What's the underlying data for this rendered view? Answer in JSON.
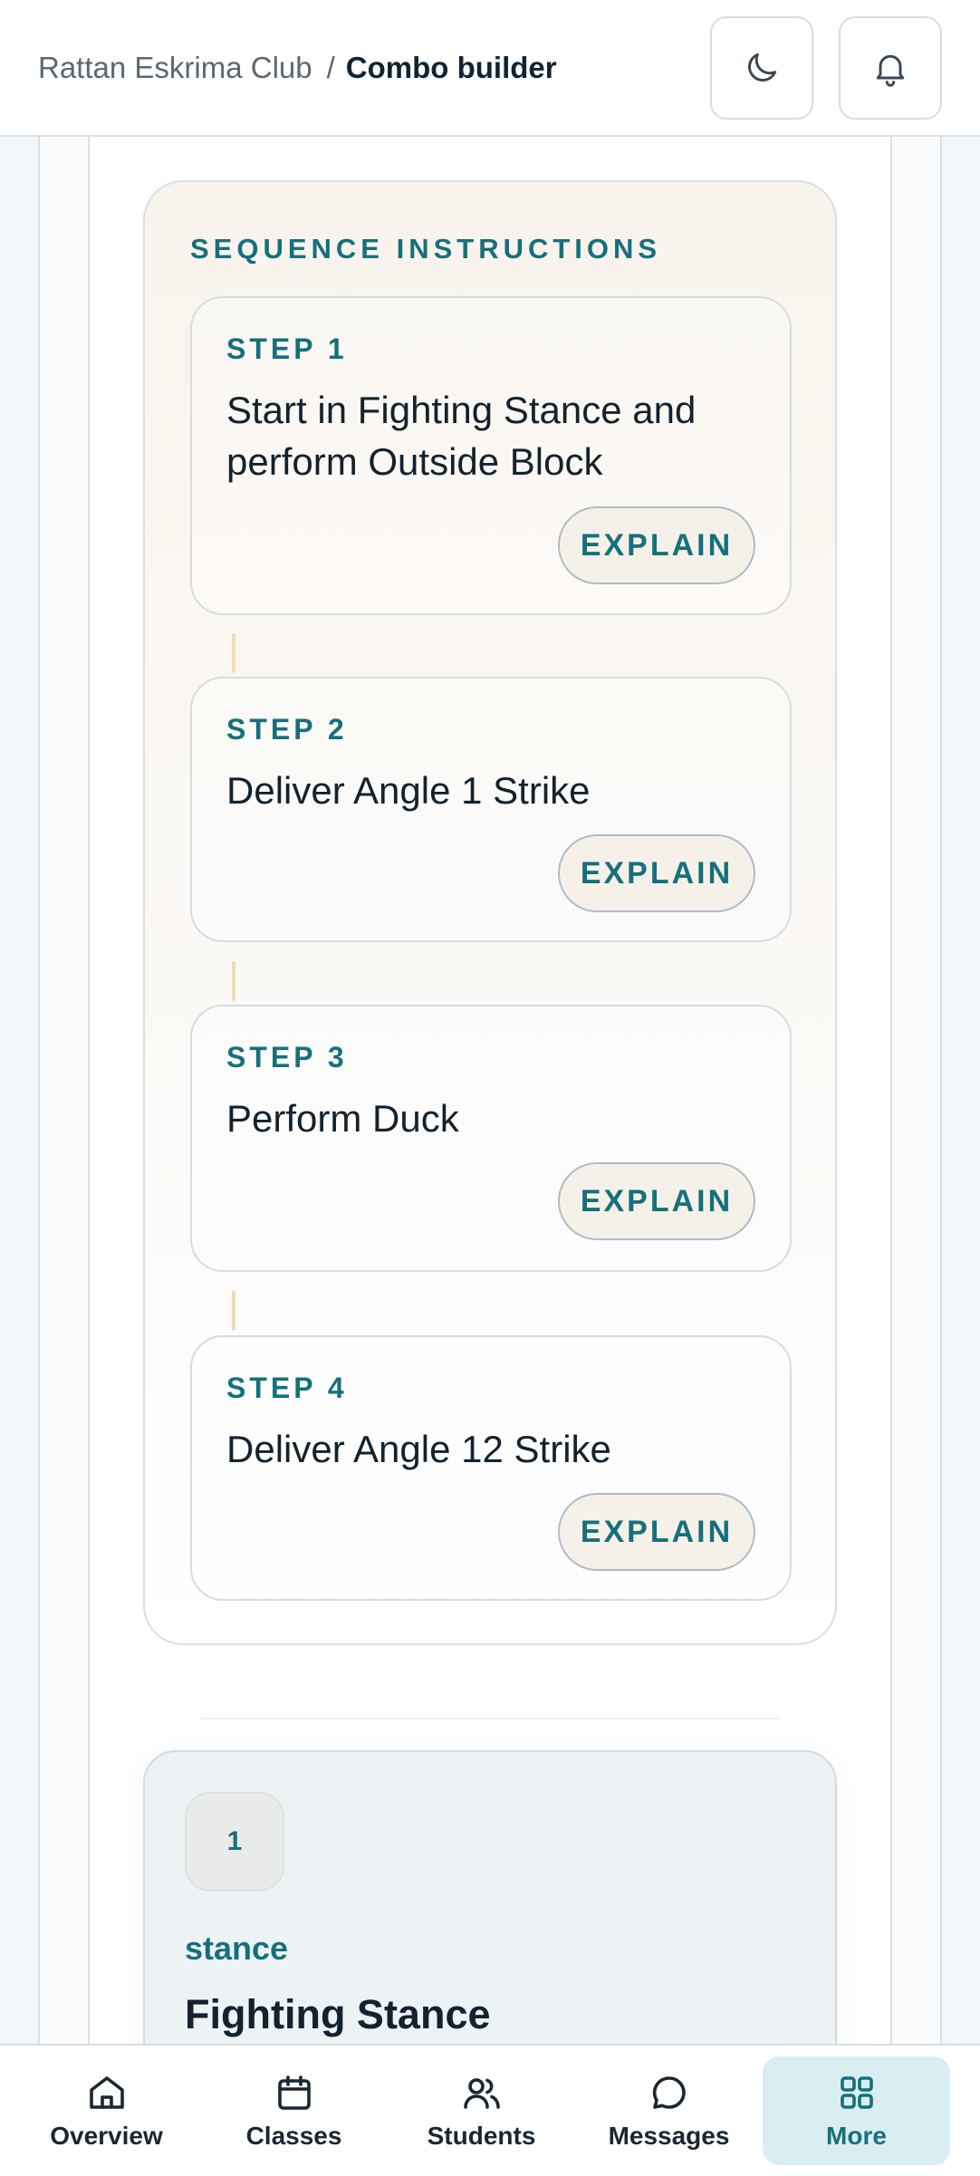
{
  "header": {
    "breadcrumb_club": "Rattan Eskrima Club",
    "breadcrumb_separator": "/",
    "breadcrumb_current": "Combo builder",
    "theme_toggle_icon": "moon-icon",
    "notifications_icon": "bell-icon"
  },
  "instructions": {
    "title": "SEQUENCE INSTRUCTIONS",
    "steps": [
      {
        "label": "STEP 1",
        "text": "Start in Fighting Stance and perform Outside Block",
        "button": "EXPLAIN"
      },
      {
        "label": "STEP 2",
        "text": "Deliver Angle 1 Strike",
        "button": "EXPLAIN"
      },
      {
        "label": "STEP 3",
        "text": "Perform Duck",
        "button": "EXPLAIN"
      },
      {
        "label": "STEP 4",
        "text": "Deliver Angle 12 Strike",
        "button": "EXPLAIN"
      }
    ]
  },
  "move_card": {
    "number": "1",
    "type": "stance",
    "name": "Fighting Stance"
  },
  "nav": {
    "items": [
      {
        "label": "Overview",
        "icon": "home-icon",
        "active": false
      },
      {
        "label": "Classes",
        "icon": "calendar-icon",
        "active": false
      },
      {
        "label": "Students",
        "icon": "users-icon",
        "active": false
      },
      {
        "label": "Messages",
        "icon": "message-icon",
        "active": false
      },
      {
        "label": "More",
        "icon": "grid-icon",
        "active": true
      }
    ]
  },
  "colors": {
    "accent": "#15707c",
    "text": "#13222e",
    "nav_active_bg": "#d9eef1"
  }
}
